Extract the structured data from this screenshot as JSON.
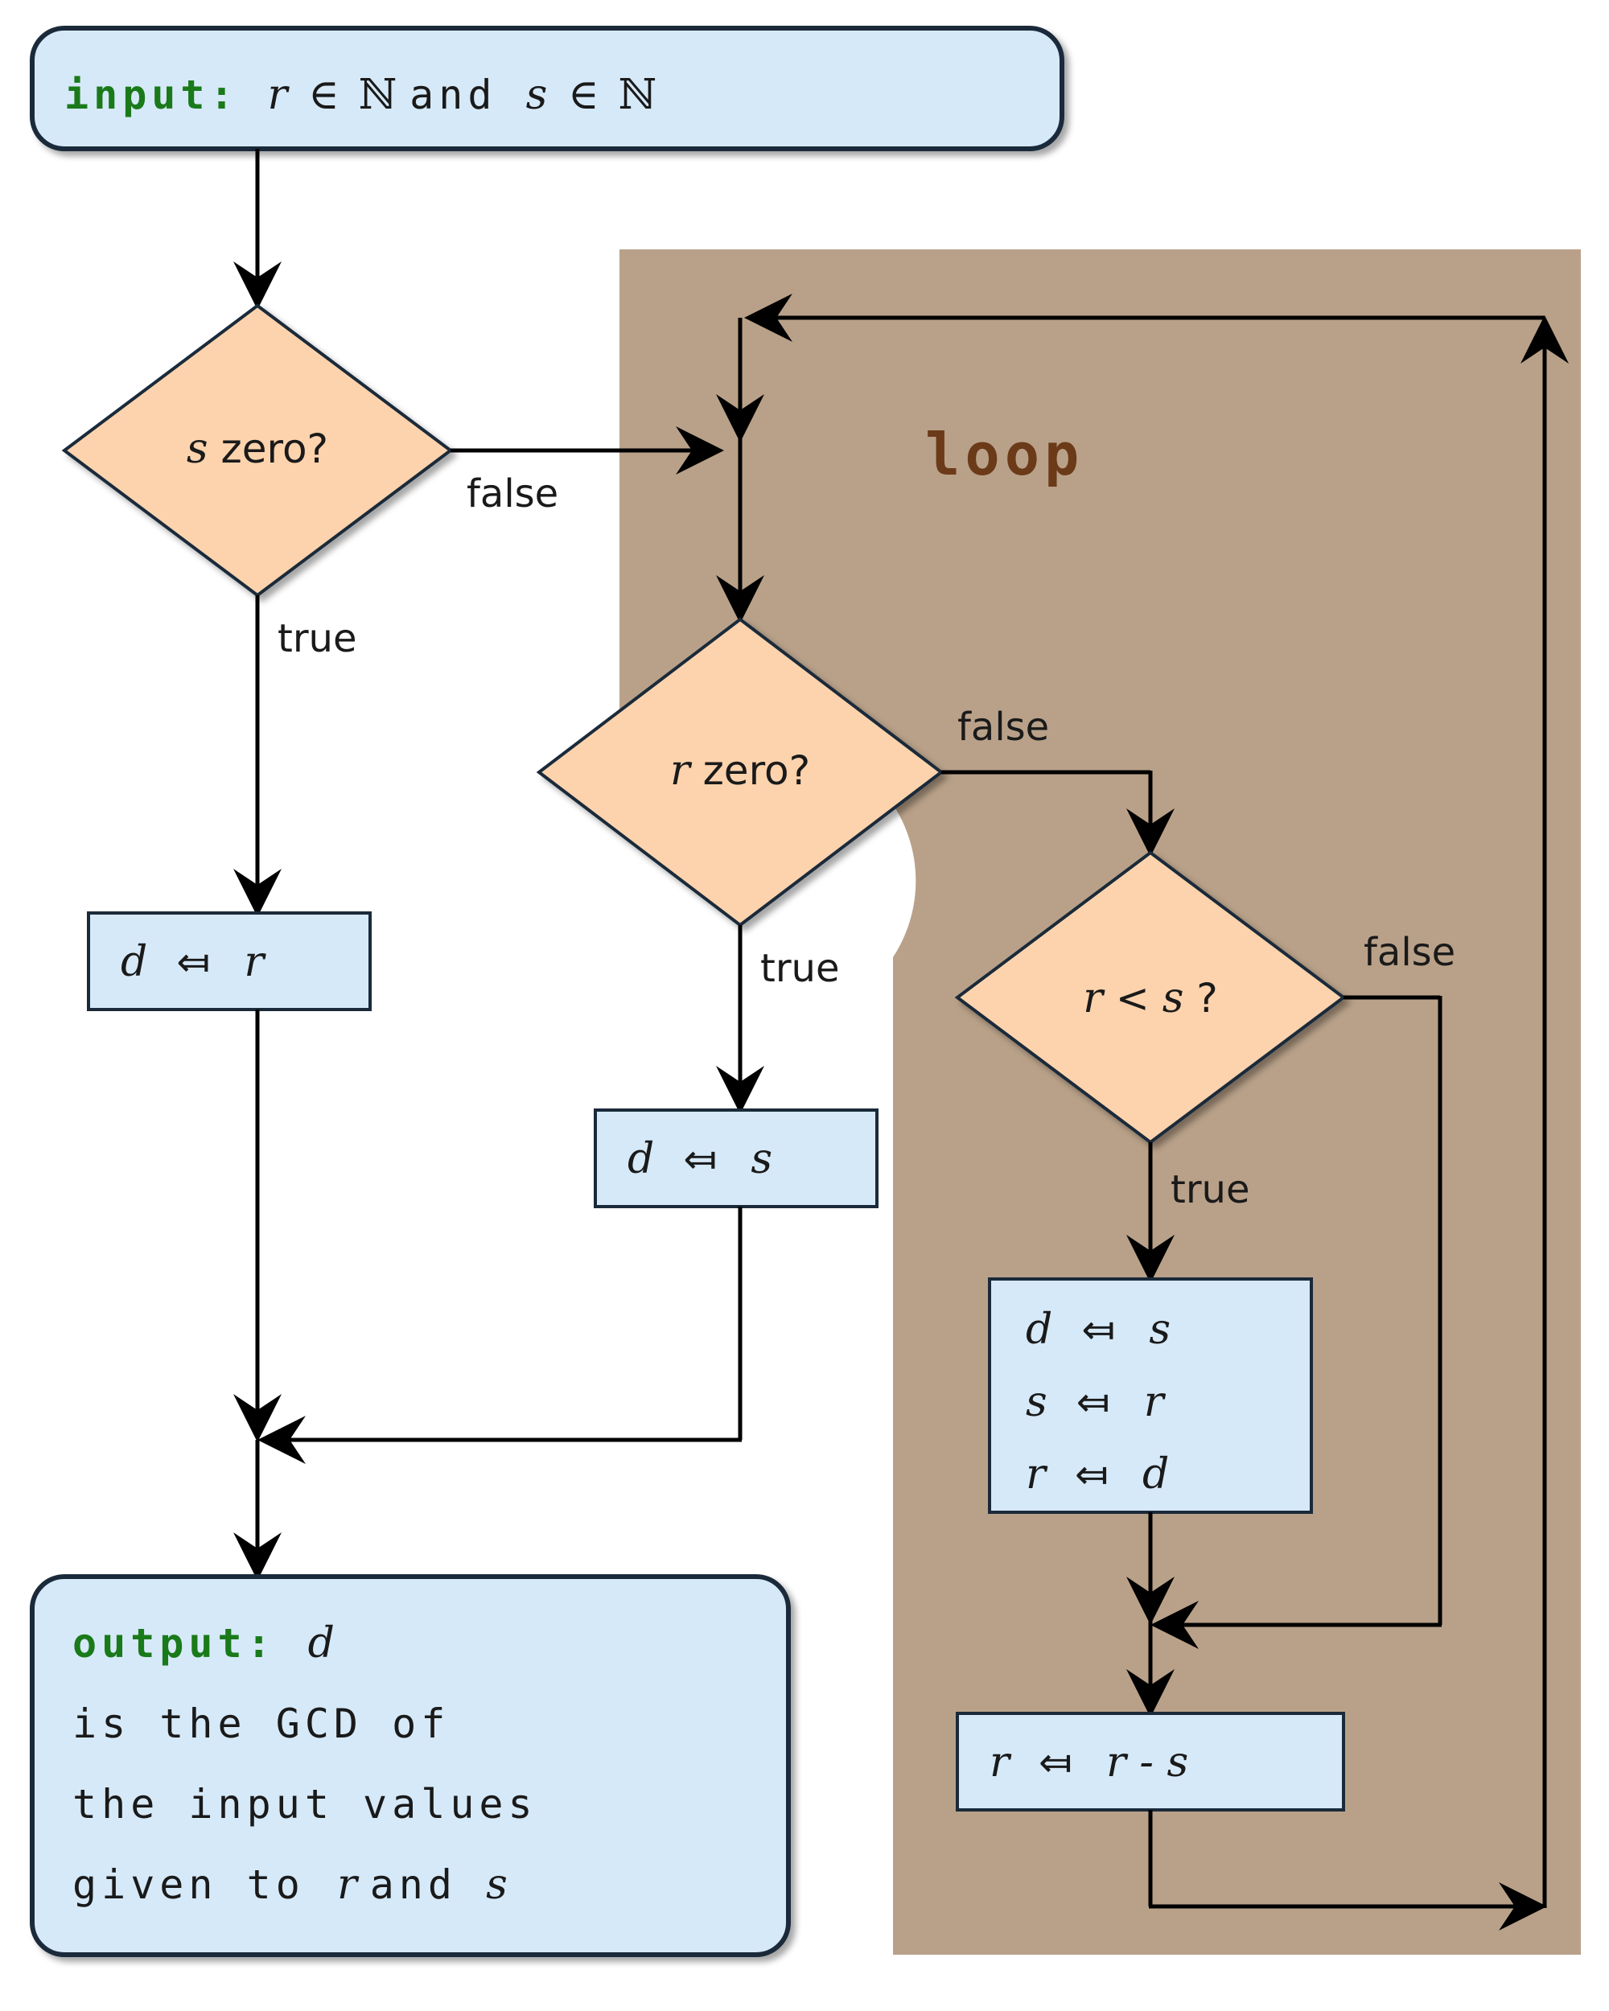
{
  "io": {
    "input_kw": "input:",
    "input_expr_r": "r",
    "input_in1": "∈",
    "input_N1": "ℕ",
    "input_and": " and ",
    "input_expr_s": "s",
    "input_in2": "∈",
    "input_N2": "ℕ",
    "output_kw": "output:",
    "output_var": "d",
    "output_line1a": "is  the  GCD  of",
    "output_line2a": "the  input  values",
    "output_line3a": "given to ",
    "output_r": "r",
    "output_and": " and ",
    "output_s": "s"
  },
  "decisions": {
    "s_zero_var": "s",
    "s_zero_txt": " zero?",
    "r_zero_var": "r",
    "r_zero_txt": " zero?",
    "r_lt_s_l": "r",
    "r_lt_s_op": " < ",
    "r_lt_s_r": "s",
    "r_lt_s_q": " ?"
  },
  "processes": {
    "d_r_lhs": "d",
    "d_r_op": " ⤆ ",
    "d_r_rhs": "r",
    "d_s_lhs": "d",
    "d_s_op": " ⤆ ",
    "d_s_rhs": "s",
    "swap_l1_lhs": "d",
    "swap_l1_op": " ⤆ ",
    "swap_l1_rhs": "s",
    "swap_l2_lhs": "s",
    "swap_l2_op": " ⤆ ",
    "swap_l2_rhs": "r",
    "swap_l3_lhs": "r",
    "swap_l3_op": " ⤆ ",
    "swap_l3_rhs": "d",
    "sub_lhs": "r",
    "sub_op": " ⤆ ",
    "sub_rhs": "r - s"
  },
  "labels": {
    "true": "true",
    "false": "false",
    "loop": "loop"
  }
}
